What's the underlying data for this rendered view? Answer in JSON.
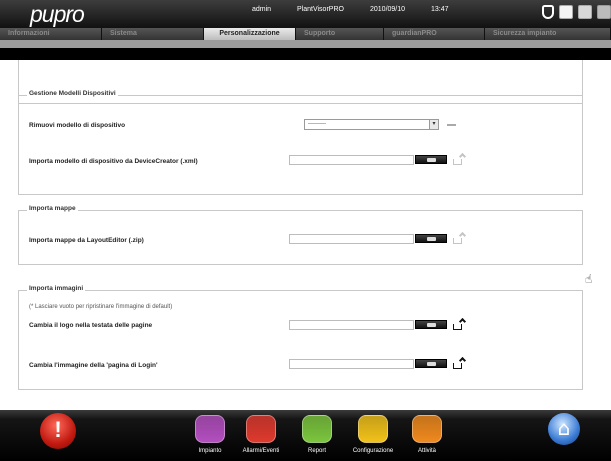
{
  "header": {
    "logo": "pupro",
    "user": "admin",
    "product": "PlantVisorPRO",
    "date": "2010/09/10",
    "time": "13:47"
  },
  "tabs": [
    {
      "label": "Informazioni"
    },
    {
      "label": "Sistema"
    },
    {
      "label": "Personalizzazione",
      "active": true
    },
    {
      "label": "Supporto"
    },
    {
      "label": "guardianPRO"
    },
    {
      "label": "Sicurezza impianto"
    }
  ],
  "sections": {
    "models": {
      "legend": "Gestione Modelli Dispositivi",
      "remove_label": "Rimuovi modello di dispositivo",
      "remove_select_value": "---------",
      "import_label": "Importa modello di dispositivo da DeviceCreator (.xml)"
    },
    "maps": {
      "legend": "Importa mappe",
      "import_label": "Importa mappe da LayoutEditor (.zip)"
    },
    "images": {
      "legend": "Importa immagini",
      "note": "(* Lasciare vuoto per ripristinare l'immagine di default)",
      "logo_label": "Cambia il logo nella testata delle pagine",
      "login_label": "Cambia l'immagine della 'pagina di Login'"
    }
  },
  "footer": {
    "buttons": [
      {
        "label": "Impianto",
        "color": "#b44fc0"
      },
      {
        "label": "Allarmi/Eventi",
        "color": "#e03a2e"
      },
      {
        "label": "Report",
        "color": "#7cc63e"
      },
      {
        "label": "Configurazione",
        "color": "#f2c21a"
      },
      {
        "label": "Attività",
        "color": "#f08a1e"
      }
    ]
  },
  "colors": {
    "header_bg": "#1a1a1a",
    "active_tab": "#d0d0d0",
    "section_border": "#c8c8c8"
  }
}
